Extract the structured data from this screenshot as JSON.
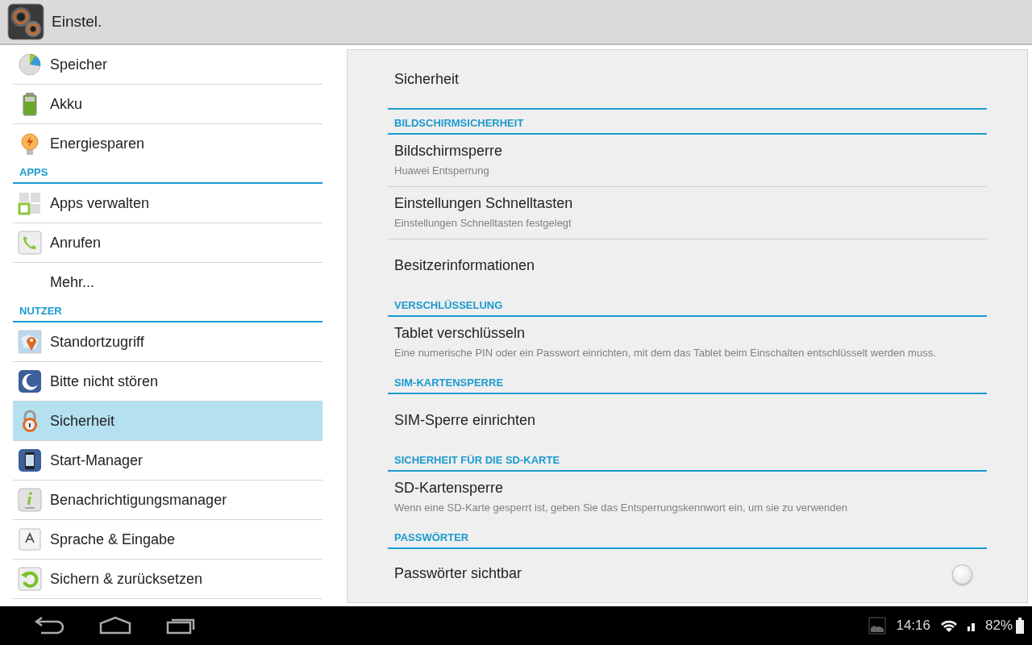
{
  "action_bar": {
    "title": "Einstel."
  },
  "sidebar": {
    "items": [
      {
        "kind": "item",
        "label": "Speicher",
        "selected": false
      },
      {
        "kind": "item",
        "label": "Akku",
        "selected": false
      },
      {
        "kind": "item",
        "label": "Energiesparen",
        "selected": false
      },
      {
        "kind": "header",
        "label": "APPS"
      },
      {
        "kind": "item",
        "label": "Apps verwalten",
        "selected": false
      },
      {
        "kind": "item",
        "label": "Anrufen",
        "selected": false
      },
      {
        "kind": "item",
        "label": "Mehr...",
        "selected": false
      },
      {
        "kind": "header",
        "label": "NUTZER"
      },
      {
        "kind": "item",
        "label": "Standortzugriff",
        "selected": false
      },
      {
        "kind": "item",
        "label": "Bitte nicht stören",
        "selected": false
      },
      {
        "kind": "item",
        "label": "Sicherheit",
        "selected": true
      },
      {
        "kind": "item",
        "label": "Start-Manager",
        "selected": false
      },
      {
        "kind": "item",
        "label": "Benachrichtigungsmanager",
        "selected": false
      },
      {
        "kind": "item",
        "label": "Sprache & Eingabe",
        "selected": false
      },
      {
        "kind": "item",
        "label": "Sichern & zurücksetzen",
        "selected": false
      }
    ]
  },
  "detail": {
    "title": "Sicherheit",
    "rows": [
      {
        "kind": "header",
        "label": "BILDSCHIRMSICHERHEIT"
      },
      {
        "kind": "item",
        "label": "Bildschirmsperre",
        "summary": "Huawei Entsperrung"
      },
      {
        "kind": "item",
        "label": "Einstellungen Schnelltasten",
        "summary": "Einstellungen Schnelltasten festgelegt"
      },
      {
        "kind": "item",
        "label": "Besitzerinformationen"
      },
      {
        "kind": "header",
        "label": "VERSCHLÜSSELUNG"
      },
      {
        "kind": "item",
        "label": "Tablet verschlüsseln",
        "summary": "Eine numerische PIN oder ein Passwort einrichten, mit dem das Tablet beim Einschalten entschlüsselt werden muss."
      },
      {
        "kind": "header",
        "label": "SIM-KARTENSPERRE"
      },
      {
        "kind": "item",
        "label": "SIM-Sperre einrichten"
      },
      {
        "kind": "header",
        "label": "SICHERHEIT FÜR DIE SD-KARTE"
      },
      {
        "kind": "item",
        "label": "SD-Kartensperre",
        "summary": "Wenn eine SD-Karte gesperrt ist, geben Sie das Entsperrungskennwort ein, um sie zu verwenden"
      },
      {
        "kind": "header",
        "label": "PASSWÖRTER"
      },
      {
        "kind": "checkbox",
        "label": "Passwörter sichtbar",
        "checked": false
      }
    ]
  },
  "status_bar": {
    "time": "14:16",
    "battery": "82%"
  }
}
